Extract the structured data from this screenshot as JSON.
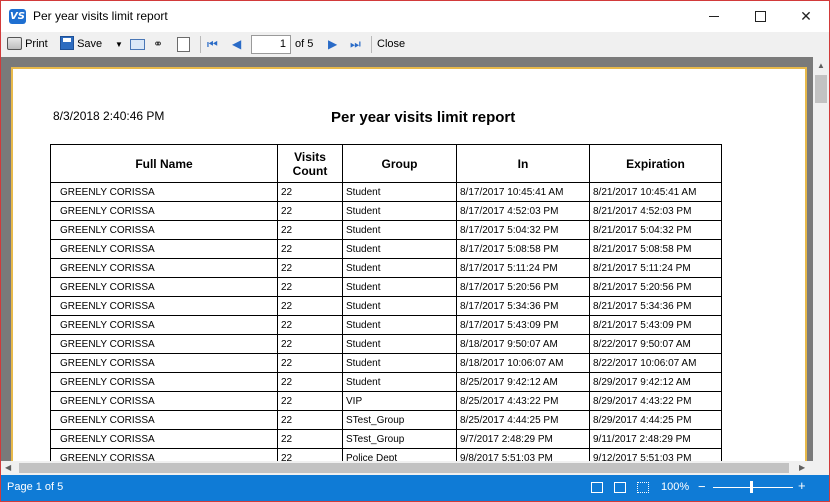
{
  "window": {
    "app_icon_text": "VS",
    "title": "Per year visits limit report"
  },
  "toolbar": {
    "print_label": "Print",
    "save_label": "Save",
    "page_value": "1",
    "page_of": "of 5",
    "close_label": "Close"
  },
  "report": {
    "date": "8/3/2018 2:40:46 PM",
    "title": "Per year visits limit report",
    "columns": [
      "Full Name",
      "Visits Count",
      "Group",
      "In",
      "Expiration"
    ],
    "rows": [
      [
        "GREENLY CORISSA",
        "22",
        "Student",
        "8/17/2017 10:45:41 AM",
        "8/21/2017 10:45:41 AM"
      ],
      [
        "GREENLY CORISSA",
        "22",
        "Student",
        "8/17/2017 4:52:03 PM",
        "8/21/2017 4:52:03 PM"
      ],
      [
        "GREENLY CORISSA",
        "22",
        "Student",
        "8/17/2017 5:04:32 PM",
        "8/21/2017 5:04:32 PM"
      ],
      [
        "GREENLY CORISSA",
        "22",
        "Student",
        "8/17/2017 5:08:58 PM",
        "8/21/2017 5:08:58 PM"
      ],
      [
        "GREENLY CORISSA",
        "22",
        "Student",
        "8/17/2017 5:11:24 PM",
        "8/21/2017 5:11:24 PM"
      ],
      [
        "GREENLY CORISSA",
        "22",
        "Student",
        "8/17/2017 5:20:56 PM",
        "8/21/2017 5:20:56 PM"
      ],
      [
        "GREENLY CORISSA",
        "22",
        "Student",
        "8/17/2017 5:34:36 PM",
        "8/21/2017 5:34:36 PM"
      ],
      [
        "GREENLY CORISSA",
        "22",
        "Student",
        "8/17/2017 5:43:09 PM",
        "8/21/2017 5:43:09 PM"
      ],
      [
        "GREENLY CORISSA",
        "22",
        "Student",
        "8/18/2017 9:50:07 AM",
        "8/22/2017 9:50:07 AM"
      ],
      [
        "GREENLY CORISSA",
        "22",
        "Student",
        "8/18/2017 10:06:07 AM",
        "8/22/2017 10:06:07 AM"
      ],
      [
        "GREENLY CORISSA",
        "22",
        "Student",
        "8/25/2017 9:42:12 AM",
        "8/29/2017 9:42:12 AM"
      ],
      [
        "GREENLY CORISSA",
        "22",
        "VIP",
        "8/25/2017 4:43:22 PM",
        "8/29/2017 4:43:22 PM"
      ],
      [
        "GREENLY CORISSA",
        "22",
        "STest_Group",
        "8/25/2017 4:44:25 PM",
        "8/29/2017 4:44:25 PM"
      ],
      [
        "GREENLY CORISSA",
        "22",
        "STest_Group",
        "9/7/2017 2:48:29 PM",
        "9/11/2017 2:48:29 PM"
      ],
      [
        "GREENLY CORISSA",
        "22",
        "Police Dept",
        "9/8/2017 5:51:03 PM",
        "9/12/2017 5:51:03 PM"
      ]
    ]
  },
  "statusbar": {
    "page_text": "Page 1 of 5",
    "zoom_text": "100%"
  },
  "colors": {
    "statusbar": "#0f7bd6",
    "page_border": "#e7b94b",
    "viewer_background": "#7a7a7a"
  }
}
